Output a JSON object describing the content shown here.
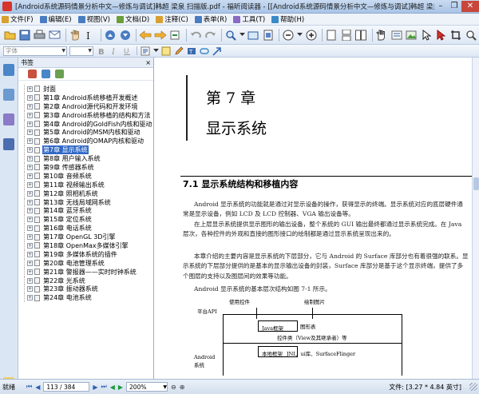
{
  "window": {
    "title": "[Android系统源码情景分析中文—修炼与调试]韩超 梁泉 扫描版.pdf - 福昕阅读器 - [[Android系统源码情景分析中文—修炼与调试]韩超 梁泉 扫描版.pdf]",
    "minimize": "–",
    "restore": "❐",
    "close": "✕"
  },
  "menu": [
    {
      "label": "文件(F)",
      "icon_color": "#d8a030"
    },
    {
      "label": "编辑(E)",
      "icon_color": "#4a7cc2"
    },
    {
      "label": "视图(V)",
      "icon_color": "#4a7cc2"
    },
    {
      "label": "文档(D)",
      "icon_color": "#6a9e3a"
    },
    {
      "label": "注释(C)",
      "icon_color": "#d8a030"
    },
    {
      "label": "表单(R)",
      "icon_color": "#4a7cc2"
    },
    {
      "label": "工具(T)",
      "icon_color": "#8a6ac2"
    },
    {
      "label": "帮助(H)",
      "icon_color": "#3a8ac8"
    }
  ],
  "toolbar2": {
    "font_placeholder": "字体",
    "size_placeholder": ""
  },
  "bookmarks_pane": {
    "title": "书签",
    "close": "×",
    "items": [
      {
        "label": "封面",
        "selected": false
      },
      {
        "label": "第1章 Android系统移植开发概述",
        "selected": false
      },
      {
        "label": "第2章 Android源代码和开发环境",
        "selected": false
      },
      {
        "label": "第3章 Android系统移植的结构和方法",
        "selected": false
      },
      {
        "label": "第4章 Android的GoldFish内核和驱动",
        "selected": false
      },
      {
        "label": "第5章 Android的MSM内核和驱动",
        "selected": false
      },
      {
        "label": "第6章 Android的OMAP内核和驱动",
        "selected": false
      },
      {
        "label": "第7章 显示系统",
        "selected": true
      },
      {
        "label": "第8章 用户输入系统",
        "selected": false
      },
      {
        "label": "第9章 传感器系统",
        "selected": false
      },
      {
        "label": "第10章 音频系统",
        "selected": false
      },
      {
        "label": "第11章 视频输出系统",
        "selected": false
      },
      {
        "label": "第12章 照相机系统",
        "selected": false
      },
      {
        "label": "第13章 无线局域网系统",
        "selected": false
      },
      {
        "label": "第14章 蓝牙系统",
        "selected": false
      },
      {
        "label": "第15章 定位系统",
        "selected": false
      },
      {
        "label": "第16章 电话系统",
        "selected": false
      },
      {
        "label": "第17章 OpenGL 3D引擎",
        "selected": false
      },
      {
        "label": "第18章 OpenMax多媒体引擎",
        "selected": false
      },
      {
        "label": "第19章 多媒体系统的插件",
        "selected": false
      },
      {
        "label": "第20章 电池管理系统",
        "selected": false
      },
      {
        "label": "第21章 警报器——实时时钟系统",
        "selected": false
      },
      {
        "label": "第22章 光系统",
        "selected": false
      },
      {
        "label": "第23章 振动器系统",
        "selected": false
      },
      {
        "label": "第24章 电池系统",
        "selected": false
      }
    ]
  },
  "page": {
    "chapter_num": "第 7 章",
    "chapter_title": "显示系统",
    "section_title": "7.1   显示系统结构和移植内容",
    "paragraphs": [
      "Android 显示系统的功能就是通过对显示设备的操作，获得显示的终端。显示系统对应的底层硬件通常是显示设备，例如 LCD 及 LCD 控制器、VGA 输出设备等。",
      "在上层显示系统提供显示图形的输出设备，整个系统的 GUI 输出最终都通过显示系统完成。在 Java 层次，各种控件的外观和直接的图形接口的绘制都是通过显示系统呈现出来的。",
      "本章介绍的主要内容是显示系统的下层部分，它与 Android 的 Surface 库部分也有着很强的联系。显示系统的下层部分提供的是基本的显示输出设备的封装，Surface 库部分是基于这个显示终端，提供了多个图层的支持以及图层间的效果等功能。",
      "Android 显示系统的基本层次结构如图 7-1 所示。"
    ],
    "diagram": {
      "platform_api": "平台API",
      "use_control": "使用控件",
      "draw_image": "绘制图片",
      "java_layer": "Java框架",
      "graphics": "图形表",
      "control_class": "控件类（View及其继承者）等",
      "native_layer": "本地框架",
      "jni": "JNI、ui库、SurfaceFlinger",
      "android_system": "Android\n系统"
    }
  },
  "status": {
    "ready": "就绪",
    "page_indicator": "113 / 384",
    "zoom": "200%",
    "doc_size": "文件: [3.27 * 4.84 英寸]"
  }
}
